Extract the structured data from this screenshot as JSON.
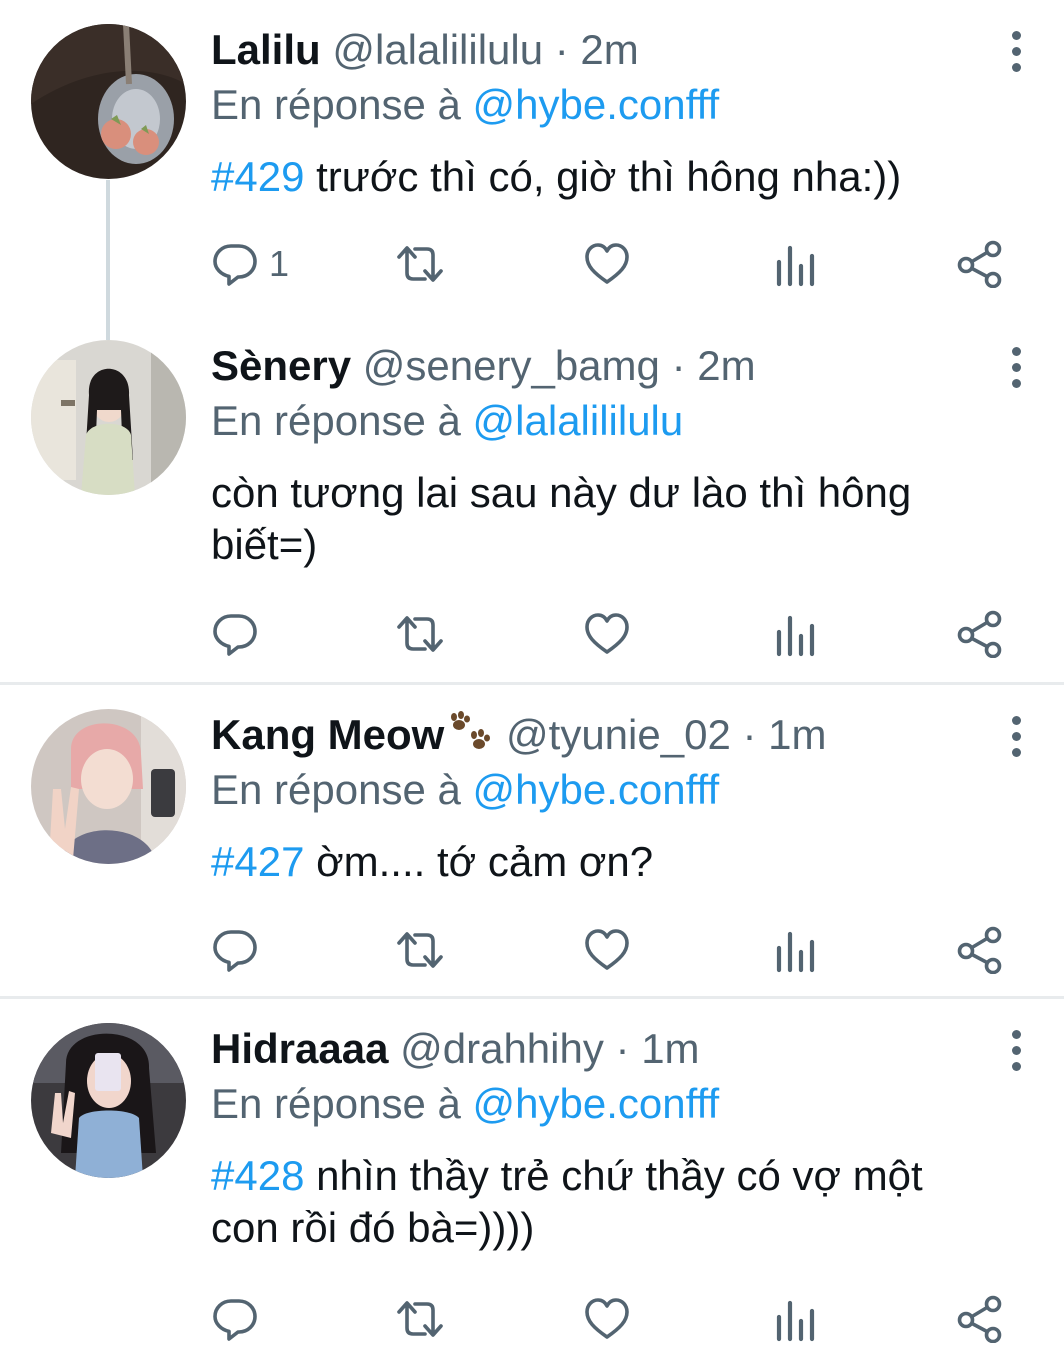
{
  "colors": {
    "accent": "#1d9bf0",
    "secondary_text": "#536471",
    "primary_text": "#0f1419",
    "divider": "#e8ebed",
    "thread_line": "#cfd9de"
  },
  "reply_prefix": "En réponse à",
  "tweets": [
    {
      "name": "Lalilu",
      "handle": "@lalalililulu",
      "separator": "·",
      "time": "2m",
      "reply_to": "@hybe.confff",
      "hashtag": "#429",
      "text": " trước thì có, giờ thì hông nha:))",
      "reply_count": "1",
      "icons": [
        "reply-icon",
        "retweet-icon",
        "like-icon",
        "views-icon",
        "share-icon"
      ]
    },
    {
      "name": "Sènery",
      "handle": "@senery_bamg",
      "separator": "·",
      "time": "2m",
      "reply_to": "@lalalililulu",
      "hashtag": "",
      "text": "còn tương lai sau này dư lào thì hông biết=)",
      "reply_count": "",
      "icons": [
        "reply-icon",
        "retweet-icon",
        "like-icon",
        "views-icon",
        "share-icon"
      ]
    },
    {
      "name": "Kang Meow",
      "name_emoji": "paw-prints-emoji",
      "handle": "@tyunie_02",
      "separator": "·",
      "time": "1m",
      "reply_to": "@hybe.confff",
      "hashtag": "#427",
      "text": " ờm.... tớ cảm ơn?",
      "reply_count": "",
      "icons": [
        "reply-icon",
        "retweet-icon",
        "like-icon",
        "views-icon",
        "share-icon"
      ]
    },
    {
      "name": "Hidraaaa",
      "handle": "@drahhihy",
      "separator": "·",
      "time": "1m",
      "reply_to": "@hybe.confff",
      "hashtag": "#428",
      "text": " nhìn thầy trẻ chứ thầy có vợ một con rồi đó bà=))))",
      "reply_count": "",
      "icons": [
        "reply-icon",
        "retweet-icon",
        "like-icon",
        "views-icon",
        "share-icon"
      ]
    }
  ]
}
